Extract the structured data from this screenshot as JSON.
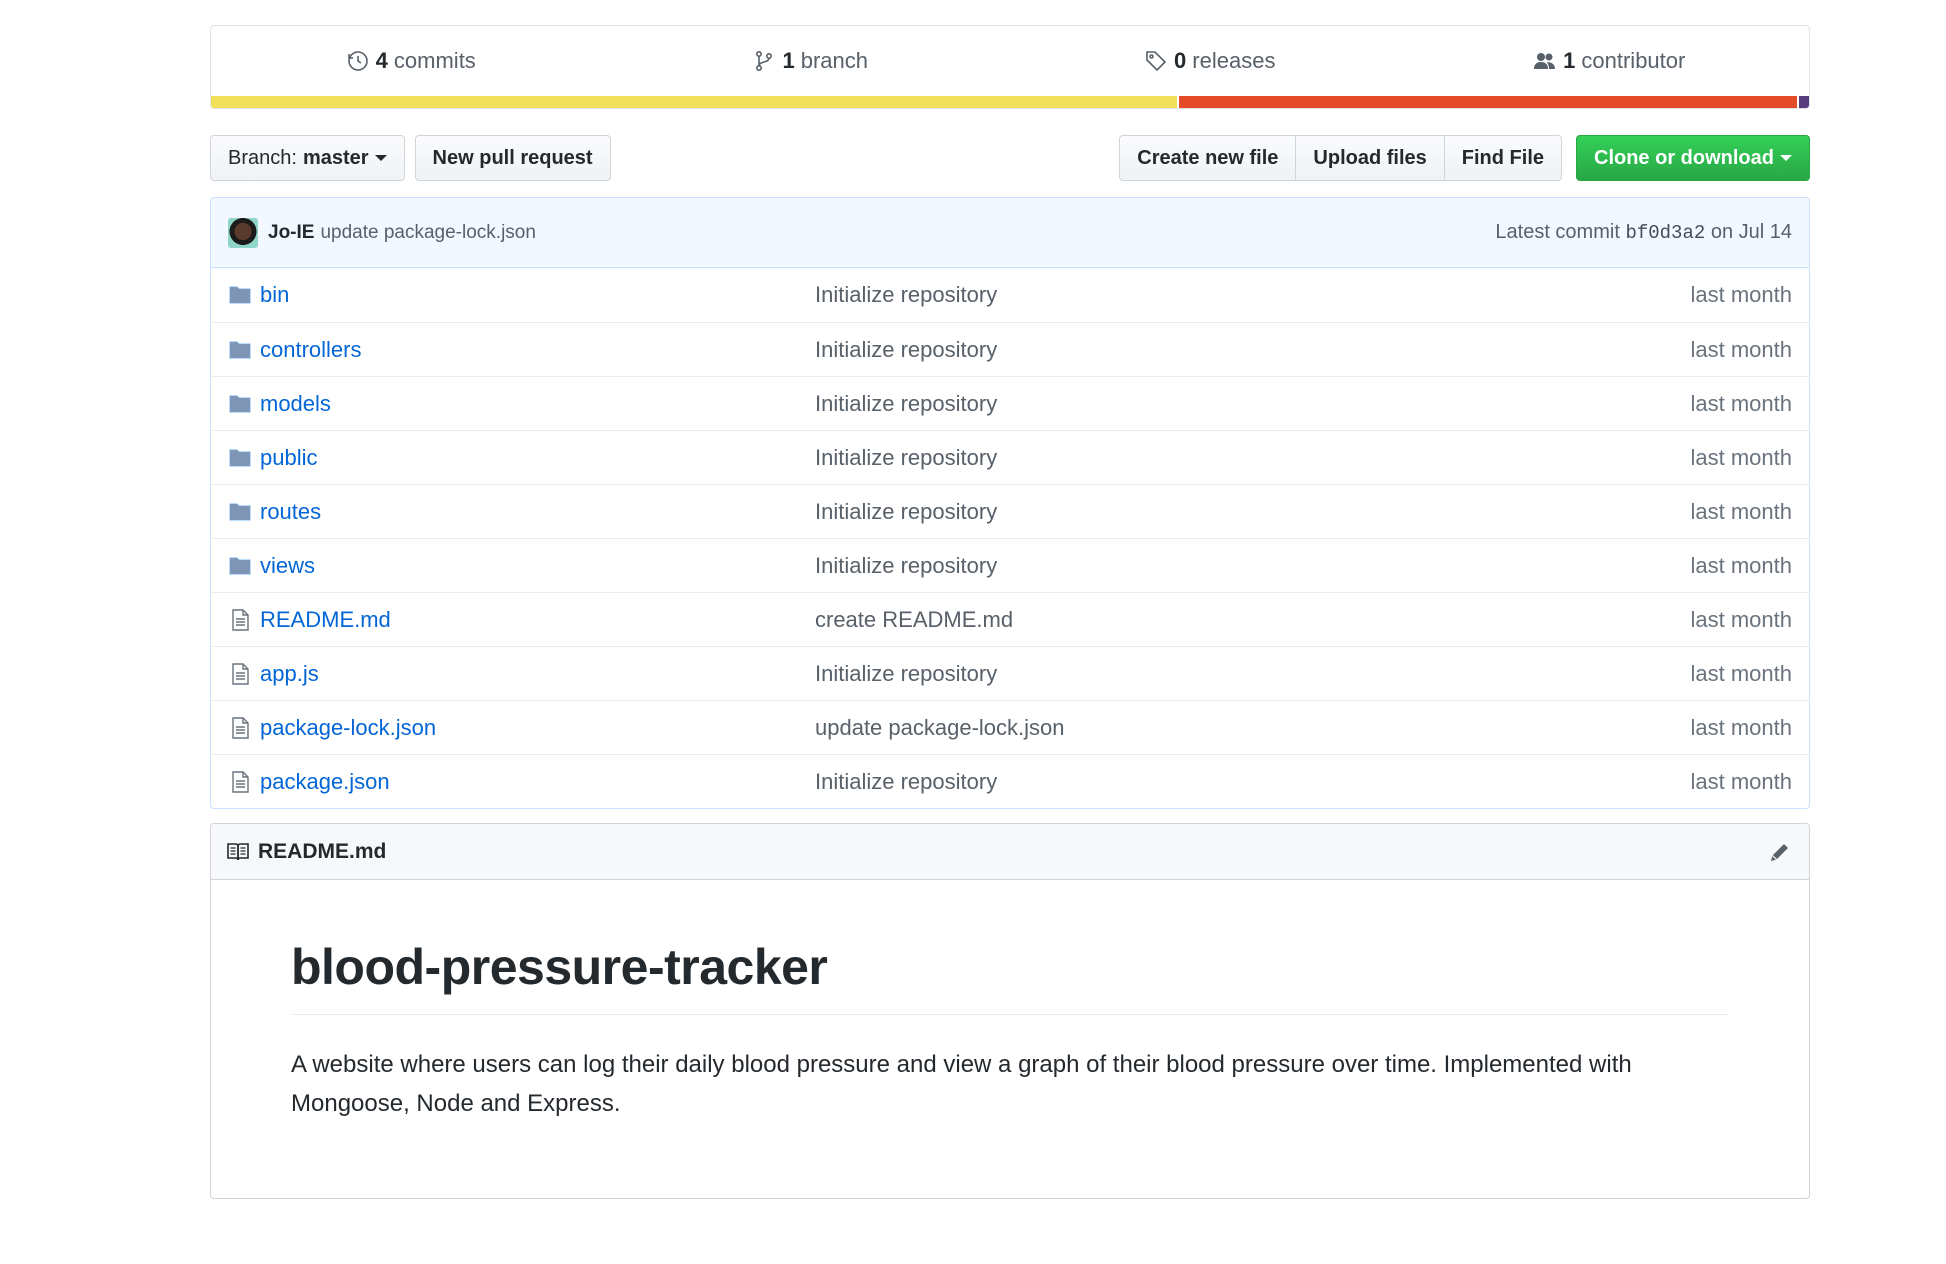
{
  "summary": {
    "commits": {
      "num": "4",
      "label": "commits"
    },
    "branches": {
      "num": "1",
      "label": "branch"
    },
    "releases": {
      "num": "0",
      "label": "releases"
    },
    "contributors": {
      "num": "1",
      "label": "contributor"
    }
  },
  "language_bar": [
    {
      "color": "#f1e05a",
      "share": 0.606
    },
    {
      "color": "#e34c26",
      "share": 0.388
    },
    {
      "color": "#563d7c",
      "share": 0.006
    }
  ],
  "toolbar": {
    "branch_prefix": "Branch:",
    "branch_name": "master",
    "new_pr": "New pull request",
    "create_file": "Create new file",
    "upload_files": "Upload files",
    "find_file": "Find File",
    "clone": "Clone or download"
  },
  "commit": {
    "author": "Jo-IE",
    "message": "update package-lock.json",
    "prefix": "Latest commit",
    "sha": "bf0d3a2",
    "date": "on Jul 14"
  },
  "files": [
    {
      "type": "folder",
      "name": "bin",
      "message": "Initialize repository",
      "age": "last month"
    },
    {
      "type": "folder",
      "name": "controllers",
      "message": "Initialize repository",
      "age": "last month"
    },
    {
      "type": "folder",
      "name": "models",
      "message": "Initialize repository",
      "age": "last month"
    },
    {
      "type": "folder",
      "name": "public",
      "message": "Initialize repository",
      "age": "last month"
    },
    {
      "type": "folder",
      "name": "routes",
      "message": "Initialize repository",
      "age": "last month"
    },
    {
      "type": "folder",
      "name": "views",
      "message": "Initialize repository",
      "age": "last month"
    },
    {
      "type": "file",
      "name": "README.md",
      "message": "create README.md",
      "age": "last month"
    },
    {
      "type": "file",
      "name": "app.js",
      "message": "Initialize repository",
      "age": "last month"
    },
    {
      "type": "file",
      "name": "package-lock.json",
      "message": "update package-lock.json",
      "age": "last month"
    },
    {
      "type": "file",
      "name": "package.json",
      "message": "Initialize repository",
      "age": "last month"
    }
  ],
  "readme": {
    "header": "README.md",
    "title": "blood-pressure-tracker",
    "body": "A website where users can log their daily blood pressure and view a graph of their blood pressure over time. Implemented with Mongoose, Node and Express."
  },
  "colors": {
    "link": "#0366d6",
    "green": "#28a745",
    "commit_bg": "#f1f8ff"
  }
}
